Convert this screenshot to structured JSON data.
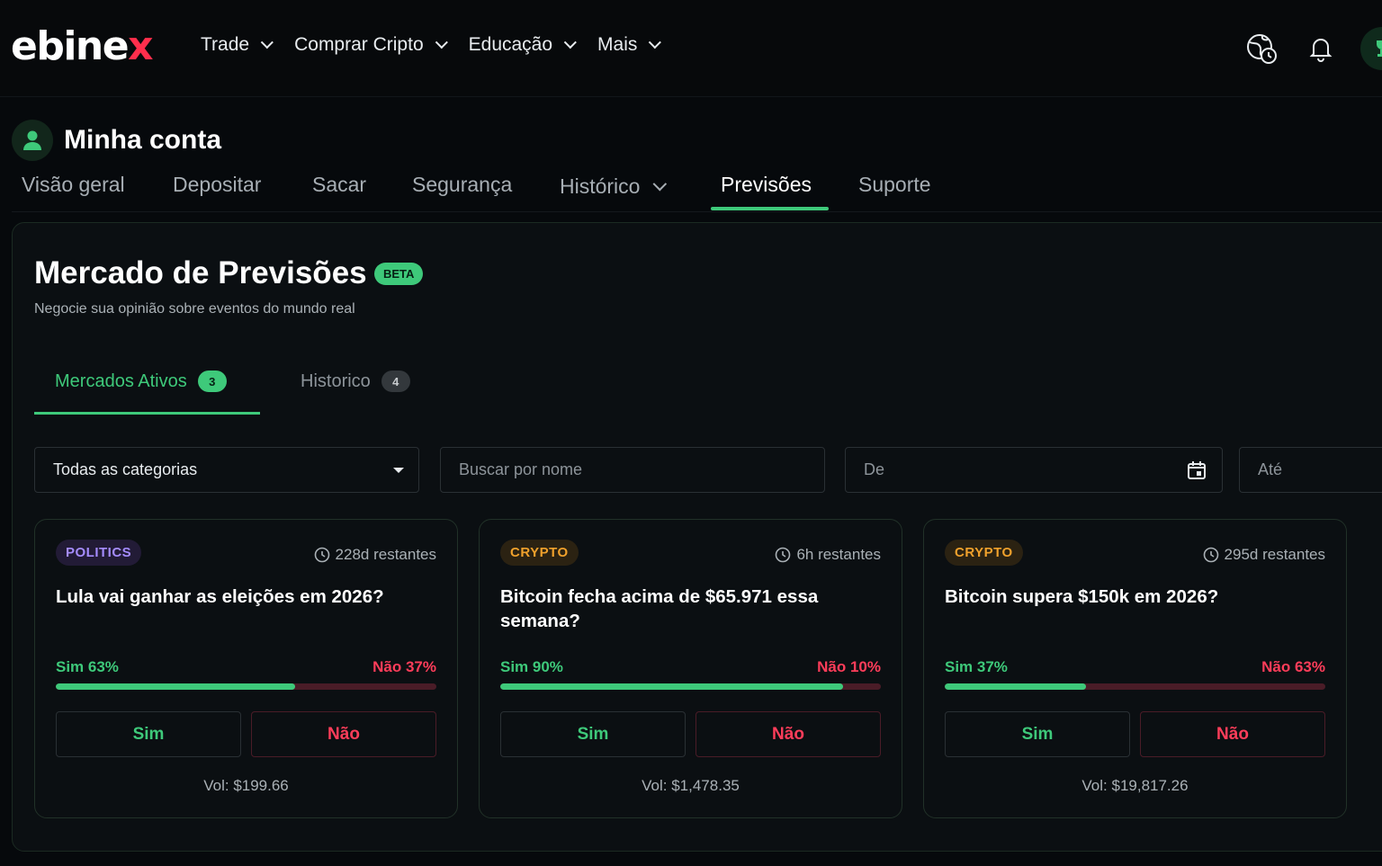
{
  "brand": {
    "logo_main": "ebine",
    "logo_x": "x"
  },
  "nav": [
    {
      "label": "Trade"
    },
    {
      "label": "Comprar Cripto"
    },
    {
      "label": "Educação"
    },
    {
      "label": "Mais"
    }
  ],
  "top_icons": [
    "globe-clock-icon",
    "bell-icon",
    "trophy-icon"
  ],
  "account": {
    "title": "Minha conta"
  },
  "account_tabs": [
    {
      "label": "Visão geral"
    },
    {
      "label": "Depositar"
    },
    {
      "label": "Sacar"
    },
    {
      "label": "Segurança"
    },
    {
      "label": "Histórico"
    },
    {
      "label": "Previsões"
    },
    {
      "label": "Suporte"
    }
  ],
  "active_account_tab": "Previsões",
  "market": {
    "title": "Mercado de Previsões",
    "badge": "BETA",
    "subtitle": "Negocie sua opinião sobre eventos do mundo real",
    "tabs": [
      {
        "label": "Mercados Ativos",
        "count": "3"
      },
      {
        "label": "Historico",
        "count": "4"
      }
    ],
    "filters": {
      "category": "Todas as categorias",
      "search_placeholder": "Buscar por nome",
      "from_placeholder": "De",
      "to_placeholder": "Até"
    },
    "cards": [
      {
        "category": "POLITICS",
        "remaining": "228d restantes",
        "question": "Lula vai ganhar as eleições em 2026?",
        "yes_label": "Sim 63%",
        "no_label": "Não 37%",
        "yes_pct": 63,
        "yes_button": "Sim",
        "no_button": "Não",
        "volume": "Vol: $199.66"
      },
      {
        "category": "CRYPTO",
        "remaining": "6h restantes",
        "question": "Bitcoin fecha acima de $65.971 essa semana?",
        "yes_label": "Sim 90%",
        "no_label": "Não 10%",
        "yes_pct": 90,
        "yes_button": "Sim",
        "no_button": "Não",
        "volume": "Vol: $1,478.35"
      },
      {
        "category": "CRYPTO",
        "remaining": "295d restantes",
        "question": "Bitcoin supera $150k em 2026?",
        "yes_label": "Sim 37%",
        "no_label": "Não 63%",
        "yes_pct": 37,
        "yes_button": "Sim",
        "no_button": "Não",
        "volume": "Vol: $19,817.26"
      }
    ]
  },
  "colors": {
    "accent_green": "#3ec97a",
    "no_red": "#ff3d5a",
    "politics_purple": "#a58cff",
    "crypto_orange": "#f0a12c",
    "background": "#06090c"
  }
}
